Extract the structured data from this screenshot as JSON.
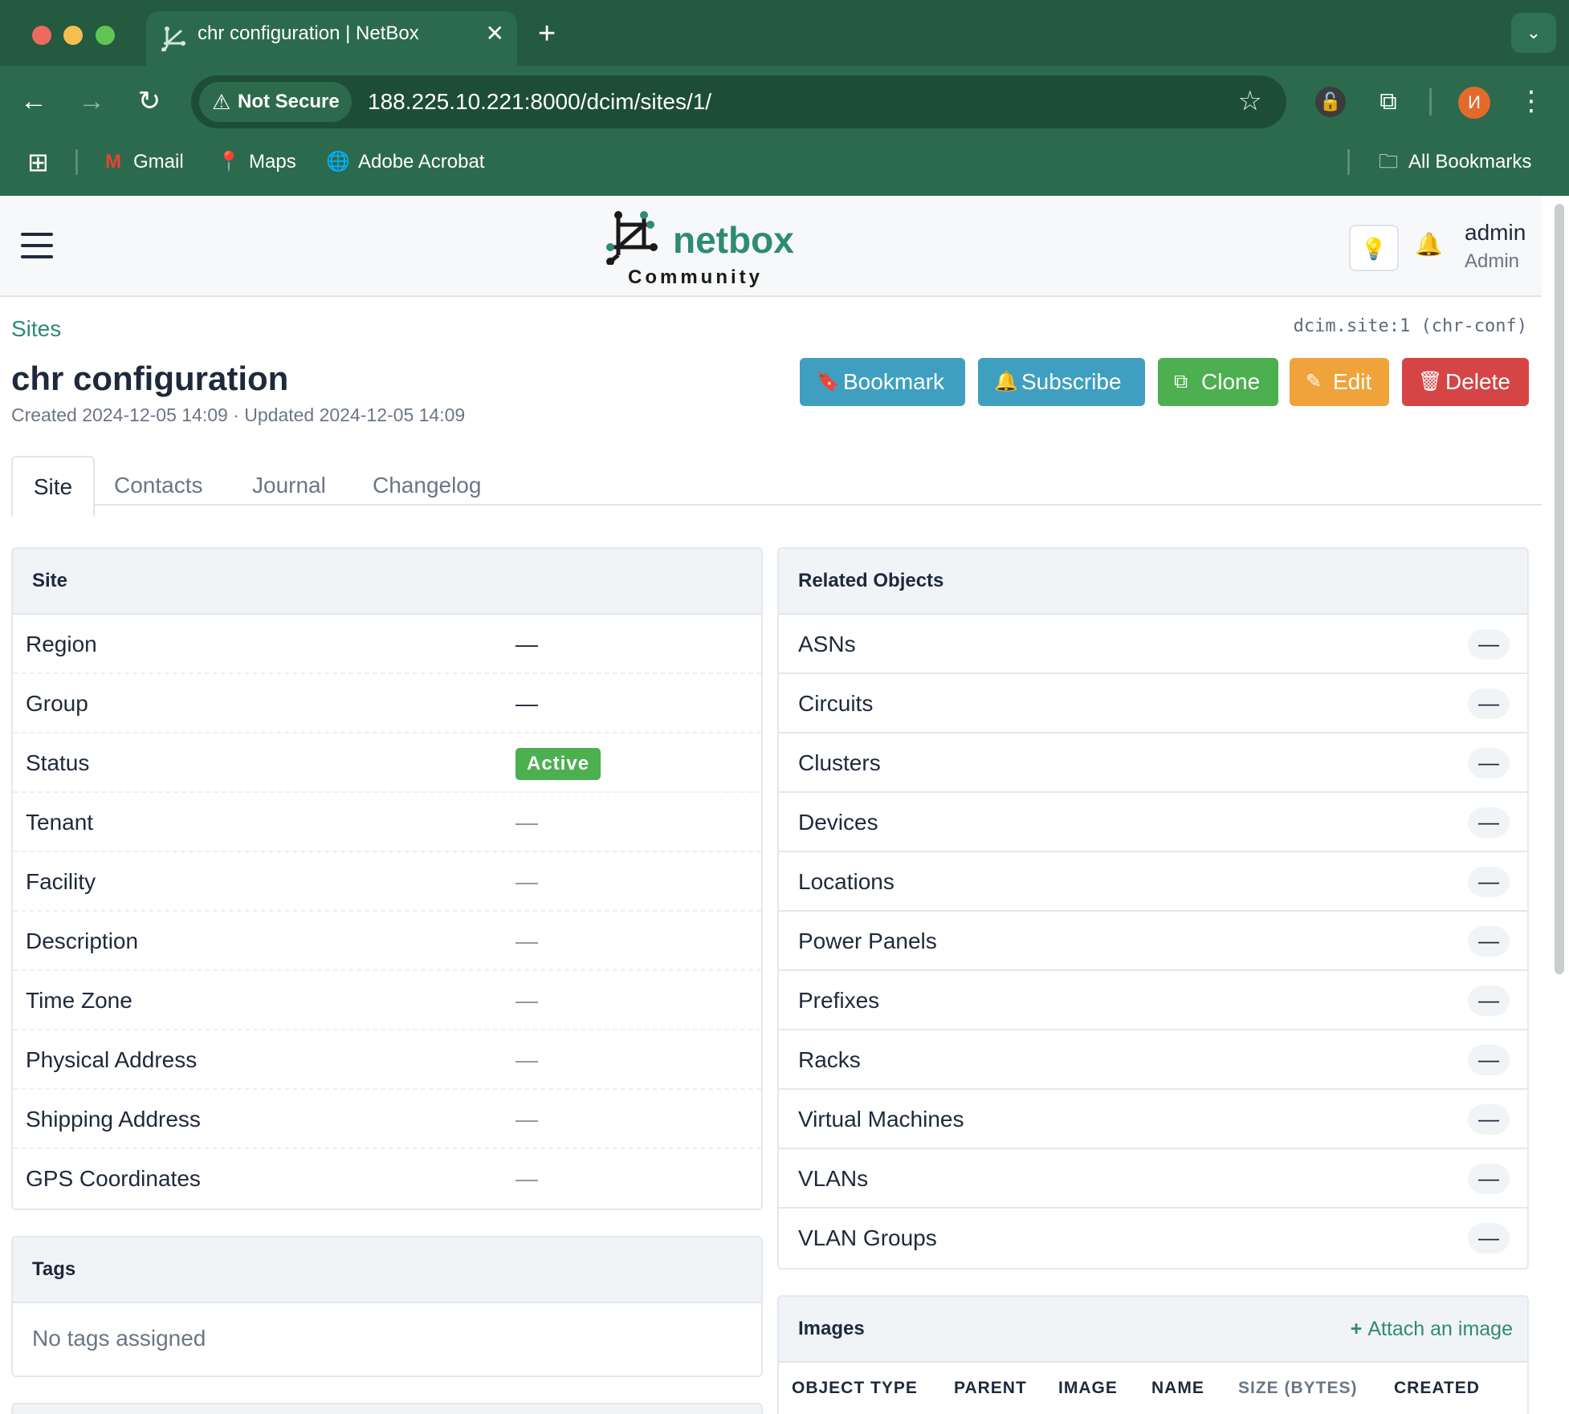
{
  "browser": {
    "tab_title": "chr configuration | NetBox",
    "security_label": "Not Secure",
    "url": "188.225.10.221:8000/dcim/sites/1/",
    "profile_initial": "И",
    "bookmarks": [
      {
        "label": "Gmail",
        "icon": "gmail-icon"
      },
      {
        "label": "Maps",
        "icon": "maps-icon"
      },
      {
        "label": "Adobe Acrobat",
        "icon": "globe-icon"
      }
    ],
    "all_bookmarks": "All Bookmarks"
  },
  "header": {
    "logo_text": "netbox",
    "logo_sub": "Community",
    "user_name": "admin",
    "user_role": "Admin"
  },
  "page": {
    "breadcrumb": "Sites",
    "object_id": "dcim.site:1 (chr-conf)",
    "title": "chr configuration",
    "meta": "Created 2024-12-05 14:09 · Updated 2024-12-05 14:09",
    "actions": {
      "bookmark": "Bookmark",
      "subscribe": "Subscribe",
      "clone": "Clone",
      "edit": "Edit",
      "delete": "Delete"
    },
    "tabs": [
      "Site",
      "Contacts",
      "Journal",
      "Changelog"
    ]
  },
  "site_card": {
    "title": "Site",
    "rows": [
      {
        "label": "Region",
        "value": "—"
      },
      {
        "label": "Group",
        "value": "—"
      },
      {
        "label": "Status",
        "value": "Active"
      },
      {
        "label": "Tenant",
        "value": "—"
      },
      {
        "label": "Facility",
        "value": "—"
      },
      {
        "label": "Description",
        "value": "—"
      },
      {
        "label": "Time Zone",
        "value": "—"
      },
      {
        "label": "Physical Address",
        "value": "—"
      },
      {
        "label": "Shipping Address",
        "value": "—"
      },
      {
        "label": "GPS Coordinates",
        "value": "—"
      }
    ]
  },
  "tags_card": {
    "title": "Tags",
    "empty": "No tags assigned"
  },
  "related_card": {
    "title": "Related Objects",
    "rows": [
      {
        "label": "ASNs",
        "count": "—"
      },
      {
        "label": "Circuits",
        "count": "—"
      },
      {
        "label": "Clusters",
        "count": "—"
      },
      {
        "label": "Devices",
        "count": "—"
      },
      {
        "label": "Locations",
        "count": "—"
      },
      {
        "label": "Power Panels",
        "count": "—"
      },
      {
        "label": "Prefixes",
        "count": "—"
      },
      {
        "label": "Racks",
        "count": "—"
      },
      {
        "label": "Virtual Machines",
        "count": "—"
      },
      {
        "label": "VLANs",
        "count": "—"
      },
      {
        "label": "VLAN Groups",
        "count": "—"
      }
    ]
  },
  "images_card": {
    "title": "Images",
    "attach": "Attach an image",
    "columns": [
      "OBJECT TYPE",
      "PARENT",
      "IMAGE",
      "NAME",
      "SIZE (BYTES)",
      "CREATED"
    ]
  },
  "colors": {
    "chrome": "#2c6a4d",
    "brand": "#2e8b74",
    "info": "#3f9fc0",
    "success": "#4caf50",
    "warning": "#f0a33a",
    "danger": "#d64545"
  }
}
